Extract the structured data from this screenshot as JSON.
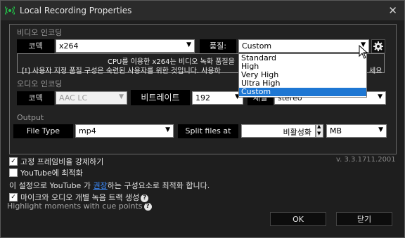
{
  "window": {
    "title": "Local Recording Properties"
  },
  "video": {
    "group_label": "비디오 인코딩",
    "codec_label": "코덱",
    "codec_value": "x264",
    "quality_label": "품질:",
    "quality_value": "Custom",
    "quality_options": [
      "Standard",
      "High",
      "Very High",
      "Ultra High",
      "Custom"
    ],
    "quality_selected_index": 4,
    "notice_line1": "CPU를 이용한 x264는 비디오 녹화 품질을",
    "notice_line2": "[!] 사용자 지정 품질 구성은 숙련된 사용자를 위한 것입니다. 사용하",
    "notice_line3": "세요"
  },
  "audio": {
    "group_label": "오디오 인코딩",
    "codec_label": "코덱",
    "codec_value": "AAC LC",
    "bitrate_label": "비트레이트",
    "bitrate_value": "192",
    "channel_label": "채널",
    "channel_value": "stereo"
  },
  "output": {
    "group_label": "Output",
    "filetype_label": "File Type",
    "filetype_value": "mp4",
    "split_label": "Split files at",
    "split_value": "비활성화",
    "split_unit": "MB",
    "version": "v. 3.3.1711.2001"
  },
  "options": {
    "force_fps_label": "고정 프레임비율 강제하기",
    "force_fps_checked": true,
    "youtube_label": "YouTube에 최적화",
    "youtube_checked": false,
    "youtube_desc_pre": "이 설정으로 YouTube 가 ",
    "youtube_desc_link": "권장",
    "youtube_desc_post": "하는 구성요소로 최적화 합니다.",
    "mic_label": "마이크와 오디오 개별 녹음 트랙 생성",
    "mic_checked": true,
    "highlight_label": "Highlight moments with cue points"
  },
  "buttons": {
    "ok": "OK",
    "close": "닫기"
  },
  "colors": {
    "selection": "#1e77d3",
    "link": "#3c8cff",
    "background": "#1e1e1e"
  },
  "icons": {
    "app": "broadcast-icon",
    "close": "close-icon",
    "settings": "gear-icon",
    "help": "question-icon",
    "dropdown": "chevron-down-icon",
    "pointer": "mouse-cursor-icon"
  }
}
